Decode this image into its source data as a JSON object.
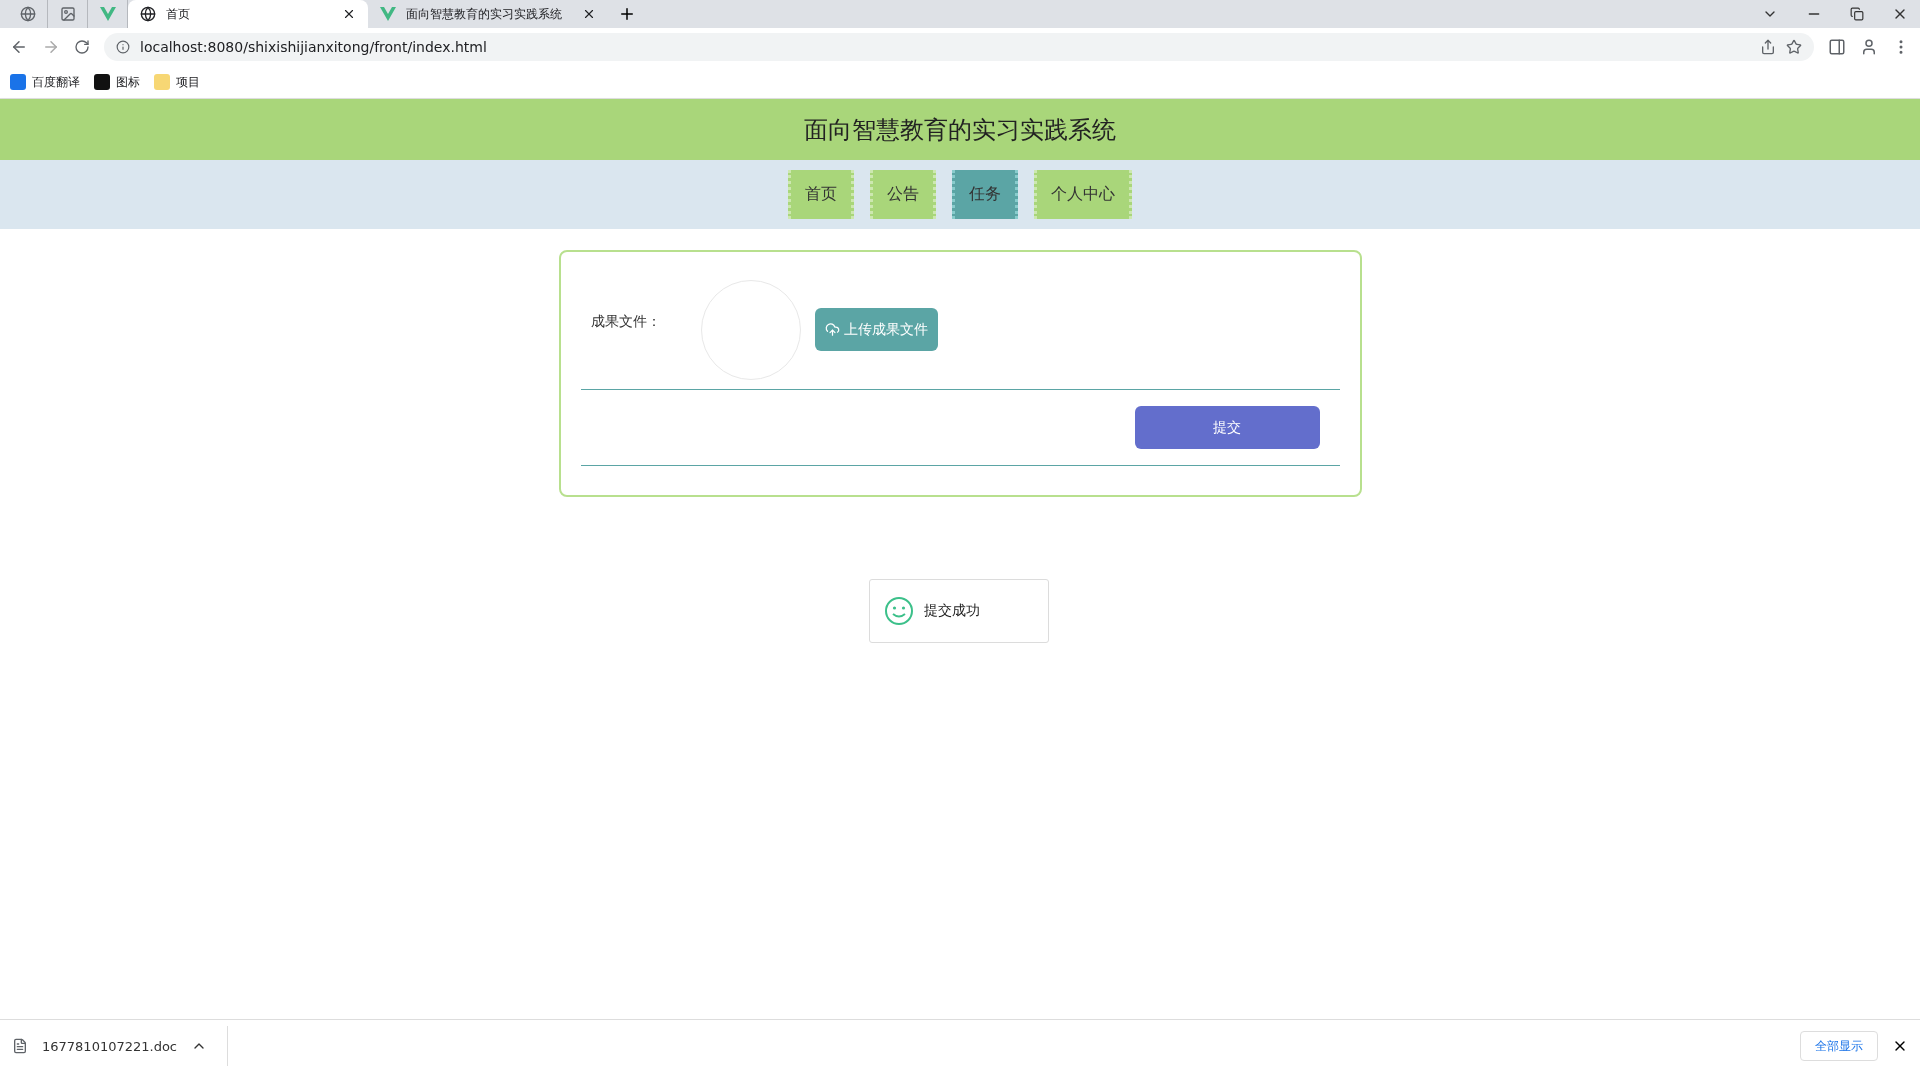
{
  "browser": {
    "tabs": [
      {
        "title": "首页",
        "selected": true
      },
      {
        "title": "面向智慧教育的实习实践系统",
        "selected": false
      }
    ],
    "address": "localhost:8080/shixishijianxitong/front/index.html",
    "bookmarks": [
      "百度翻译",
      "图标",
      "项目"
    ]
  },
  "page": {
    "title": "面向智慧教育的实习实践系统",
    "nav": [
      {
        "label": "首页",
        "selected": false
      },
      {
        "label": "公告",
        "selected": false
      },
      {
        "label": "任务",
        "selected": true
      },
      {
        "label": "个人中心",
        "selected": false
      }
    ],
    "form": {
      "file_label": "成果文件：",
      "upload_button": "上传成果文件",
      "submit_button": "提交"
    },
    "toast": "提交成功"
  },
  "download_bar": {
    "file": "1677810107221.doc",
    "show_all": "全部显示"
  }
}
